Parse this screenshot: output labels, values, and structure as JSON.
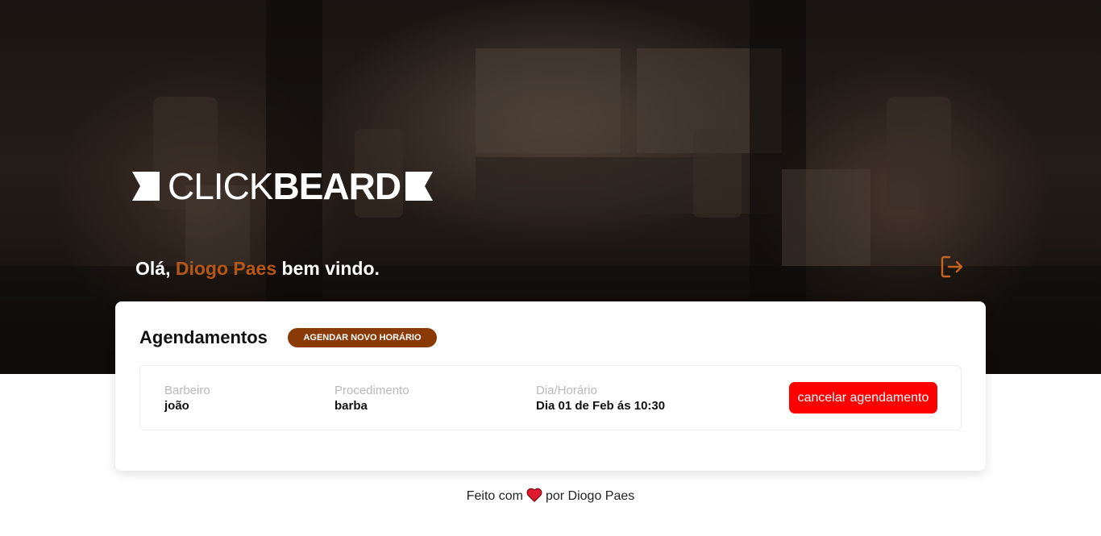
{
  "brand": {
    "light": "CLICK",
    "bold": "BEARD"
  },
  "greeting": {
    "prefix": "Olá, ",
    "name": "Diogo Paes",
    "suffix": " bem vindo."
  },
  "card": {
    "title": "Agendamentos",
    "new_button": "AGENDAR NOVO HORÁRIO",
    "appointments": [
      {
        "barber_label": "Barbeiro",
        "barber": "joão",
        "procedure_label": "Procedimento",
        "procedure": "barba",
        "datetime_label": "Dia/Horário",
        "datetime": "Dia 01 de Feb ás 10:30",
        "cancel_label": "cancelar agendamento"
      }
    ]
  },
  "footer": {
    "before": "Feito com",
    "after": "por Diogo Paes"
  },
  "icons": {
    "logout": "logout-icon",
    "heart": "heart-icon",
    "logo_flag": "flag-icon"
  },
  "colors": {
    "accent": "#b5571a",
    "button": "#8a3a06",
    "danger": "#ff0000",
    "heart": "#e0192e"
  }
}
